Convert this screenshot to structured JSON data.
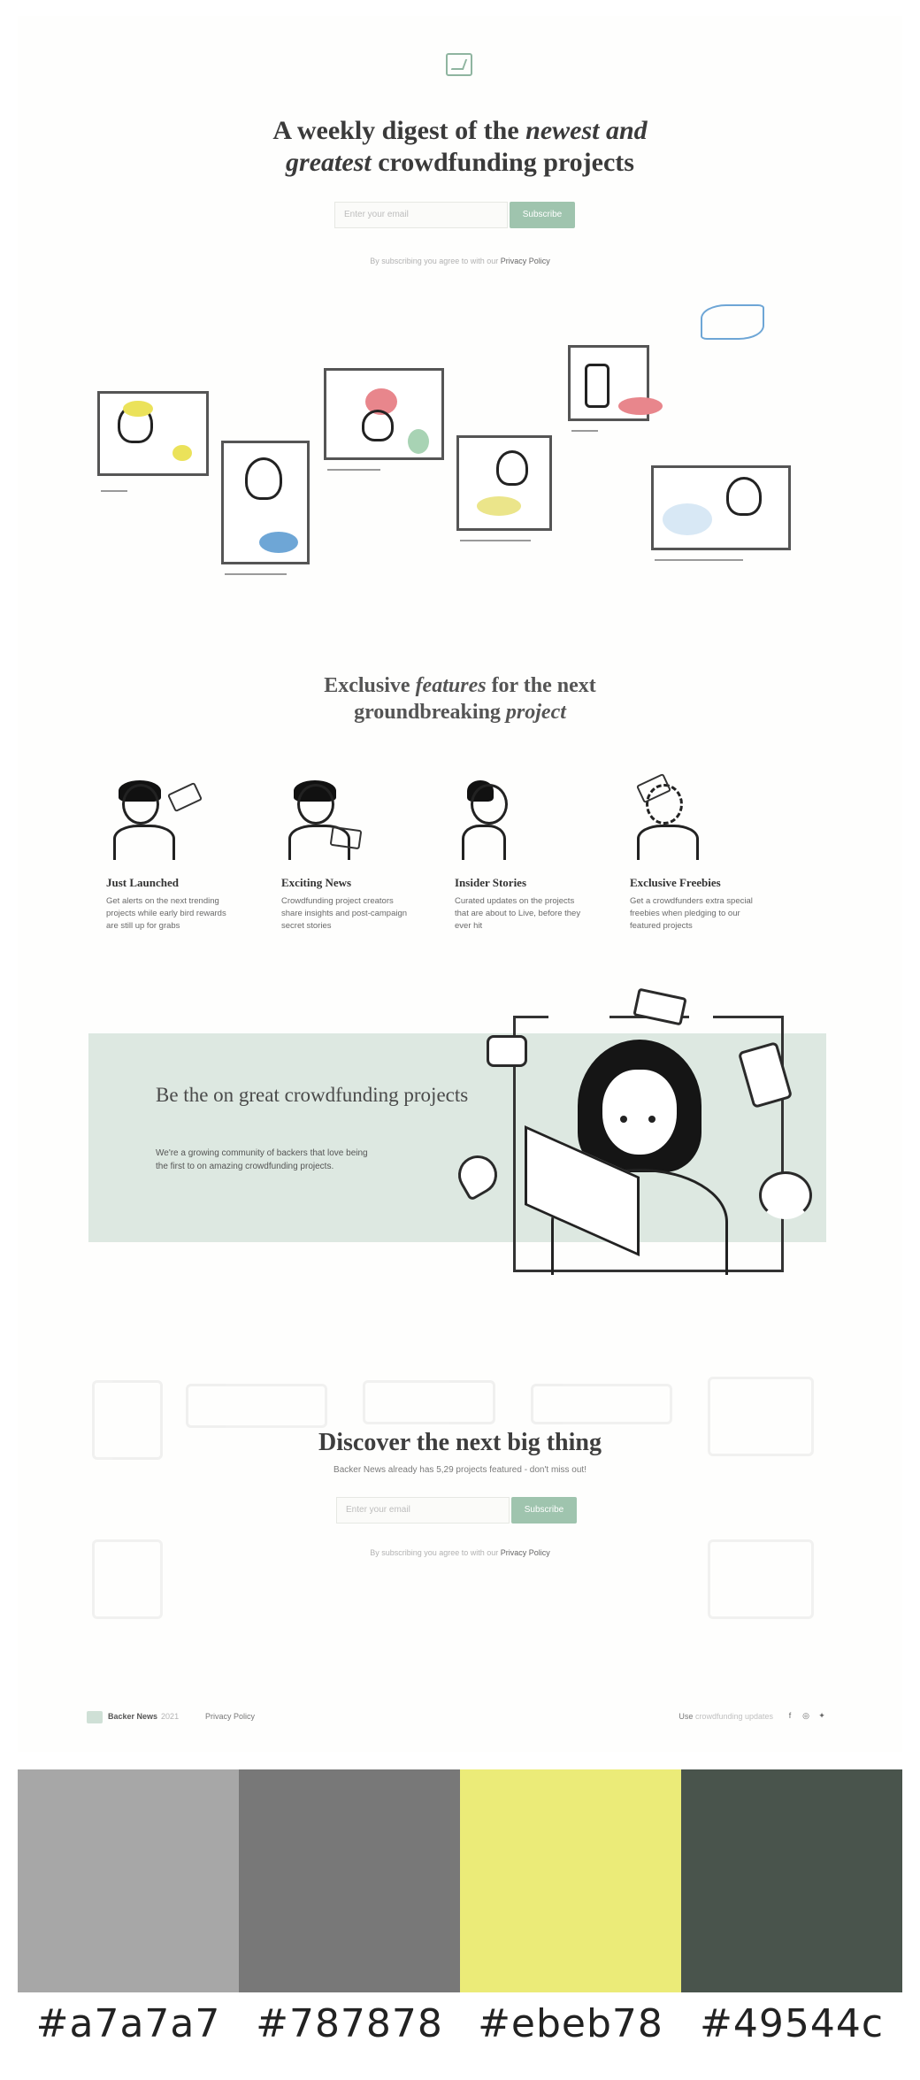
{
  "hero": {
    "title_part1": "A weekly digest of the ",
    "title_em1": "newest and",
    "title_em2": "greatest",
    "title_part2": " crowdfunding projects"
  },
  "signup": {
    "email_placeholder": "Enter your email",
    "button_label": "Subscribe",
    "agree_text": "By subscribing you agree to with our ",
    "privacy_link": "Privacy Policy"
  },
  "features": {
    "title_part1": "Exclusive ",
    "title_em1": "features",
    "title_part2": " for the next",
    "title_part3": "groundbreaking ",
    "title_em2": "project",
    "items": [
      {
        "title": "Just Launched",
        "text": "Get alerts on the next trending projects while early bird rewards are still up for grabs"
      },
      {
        "title": "Exciting News",
        "text": "Crowdfunding project creators share insights and post-campaign secret stories"
      },
      {
        "title": "Insider Stories",
        "text": "Curated updates on the projects that are about to Live, before they ever hit"
      },
      {
        "title": "Exclusive Freebies",
        "text": "Get a crowdfunders extra special freebies when pledging to our featured projects"
      }
    ]
  },
  "community": {
    "title": "Be the on great crowdfunding projects",
    "text": "We're a growing community of backers that love being the first to on amazing crowdfunding projects."
  },
  "discover": {
    "title": "Discover the next big thing",
    "subtitle": "Backer News already has 5,29 projects featured - don't miss out!",
    "email_placeholder": "Enter your email",
    "button_label": "Subscribe",
    "agree_text": "By subscribing you agree to with our ",
    "privacy_link": "Privacy Policy"
  },
  "footer": {
    "brand": "Backer News",
    "brand_suffix": "2021",
    "privacy": "Privacy Policy",
    "right_label": "Use",
    "right_text": " crowdfunding updates"
  },
  "palette": {
    "colors": [
      "#a7a7a7",
      "#787878",
      "#ebeb78",
      "#49544c"
    ],
    "labels": [
      "#a7a7a7",
      "#787878",
      "#ebeb78",
      "#49544c"
    ]
  },
  "icons": {
    "logo": "newsletter-logo-icon",
    "facebook": "f",
    "instagram": "◎",
    "twitter": "✦"
  }
}
